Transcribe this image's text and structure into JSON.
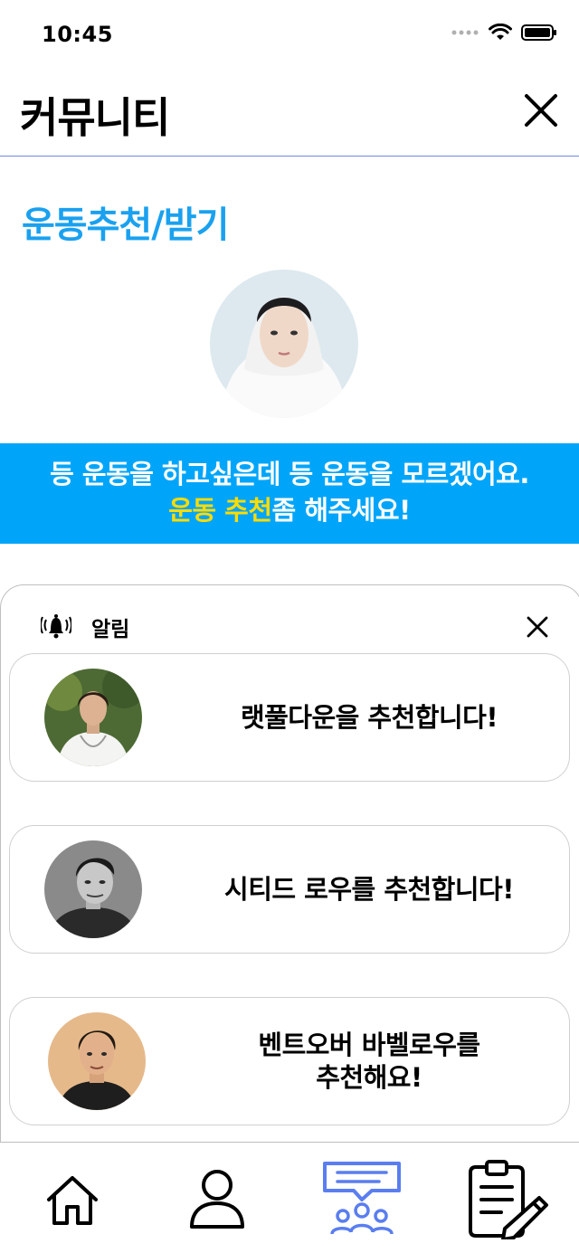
{
  "status_bar": {
    "time": "10:45"
  },
  "header": {
    "title": "커뮤니티"
  },
  "section": {
    "title": "운동추천/받기"
  },
  "banner": {
    "line1": "등 운동을 하고싶은데 등 운동을 모르겠어요.",
    "line2_highlight": "운동 추천",
    "line2_rest": "좀 해주세요!"
  },
  "notifications": {
    "title": "알림",
    "items": [
      {
        "text": "랫풀다운을 추천합니다!"
      },
      {
        "text": "시티드 로우를 추천합니다!"
      },
      {
        "text_line1": "벤트오버 바벨로우를",
        "text_line2": "추천해요!"
      }
    ]
  },
  "tabs": [
    {
      "icon": "home-icon"
    },
    {
      "icon": "person-icon"
    },
    {
      "icon": "community-icon",
      "active": true
    },
    {
      "icon": "clipboard-icon"
    }
  ],
  "colors": {
    "accent": "#1aa1ef",
    "banner_bg": "#00a5fa",
    "banner_highlight": "#ffdc00",
    "active_tab": "#5a7ef0"
  }
}
